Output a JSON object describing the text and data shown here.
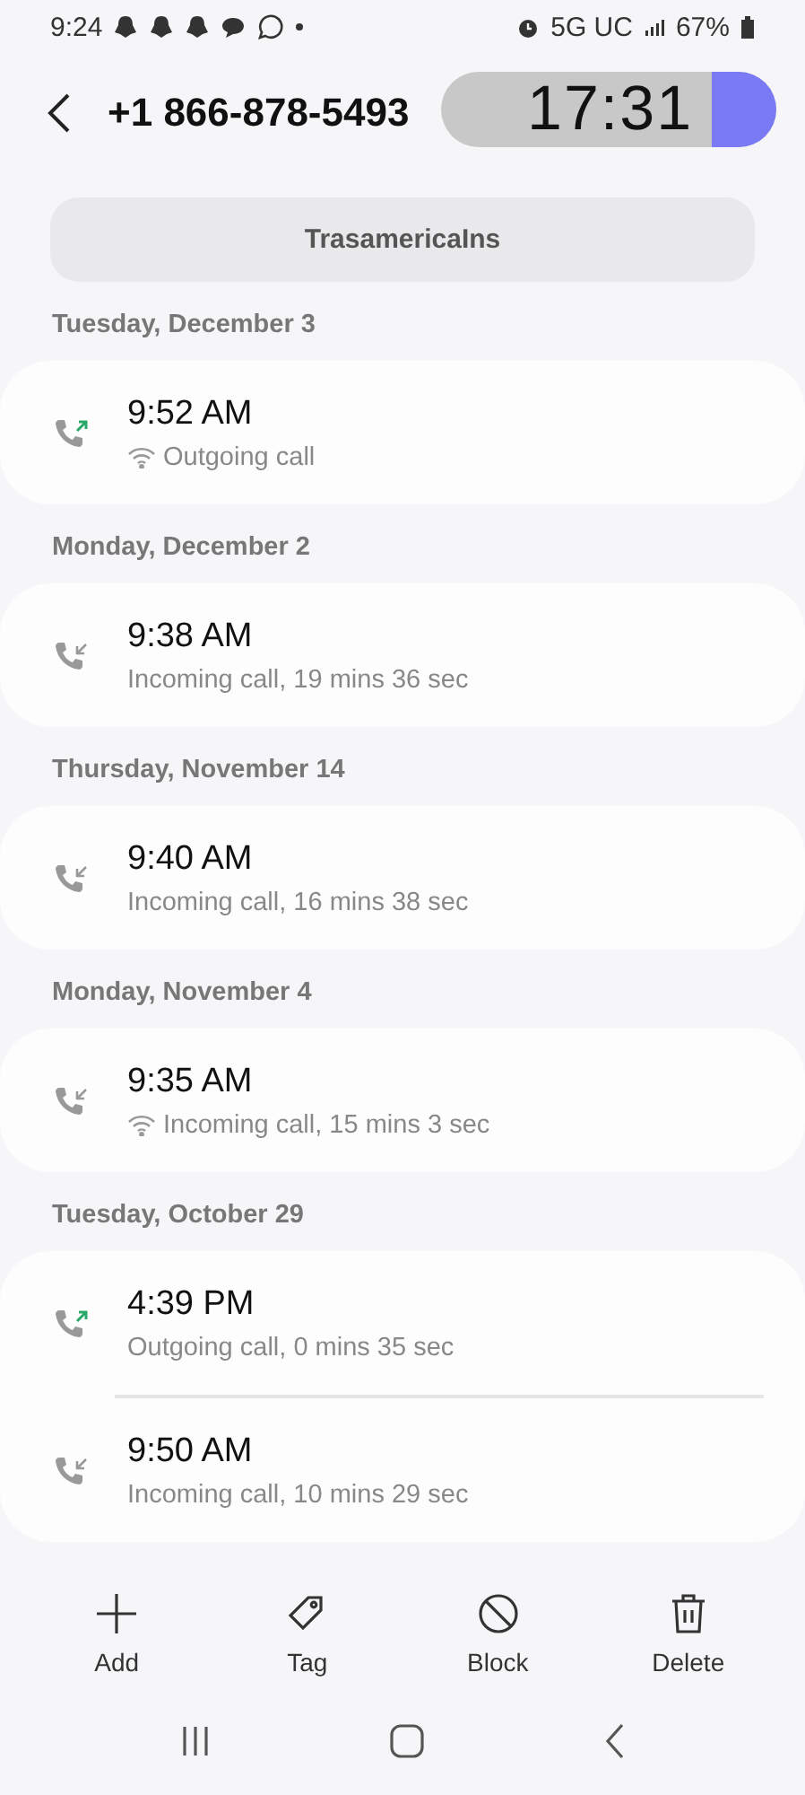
{
  "status_bar": {
    "time": "9:24",
    "network": "5G UC",
    "battery": "67%"
  },
  "overlay_timer": "17:31",
  "header": {
    "title": "+1 866-878-5493"
  },
  "contact_label": "TrasamericaIns",
  "groups": [
    {
      "date": "Tuesday, December 3",
      "calls": [
        {
          "time": "9:52 AM",
          "kind": "outgoing",
          "wifi": true,
          "detail": "Outgoing call"
        }
      ]
    },
    {
      "date": "Monday, December 2",
      "calls": [
        {
          "time": "9:38 AM",
          "kind": "incoming",
          "wifi": false,
          "detail": "Incoming call, 19 mins 36 sec"
        }
      ]
    },
    {
      "date": "Thursday, November 14",
      "calls": [
        {
          "time": "9:40 AM",
          "kind": "incoming",
          "wifi": false,
          "detail": "Incoming call, 16 mins 38 sec"
        }
      ]
    },
    {
      "date": "Monday, November 4",
      "calls": [
        {
          "time": "9:35 AM",
          "kind": "incoming",
          "wifi": true,
          "detail": "Incoming call, 15 mins 3 sec"
        }
      ]
    },
    {
      "date": "Tuesday, October 29",
      "calls": [
        {
          "time": "4:39 PM",
          "kind": "outgoing",
          "wifi": false,
          "detail": "Outgoing call, 0 mins 35 sec"
        },
        {
          "time": "9:50 AM",
          "kind": "incoming",
          "wifi": false,
          "detail": "Incoming call, 10 mins 29 sec"
        }
      ]
    }
  ],
  "actions": [
    {
      "kind": "add",
      "label": "Add"
    },
    {
      "kind": "tag",
      "label": "Tag"
    },
    {
      "kind": "block",
      "label": "Block"
    },
    {
      "kind": "delete",
      "label": "Delete"
    }
  ]
}
